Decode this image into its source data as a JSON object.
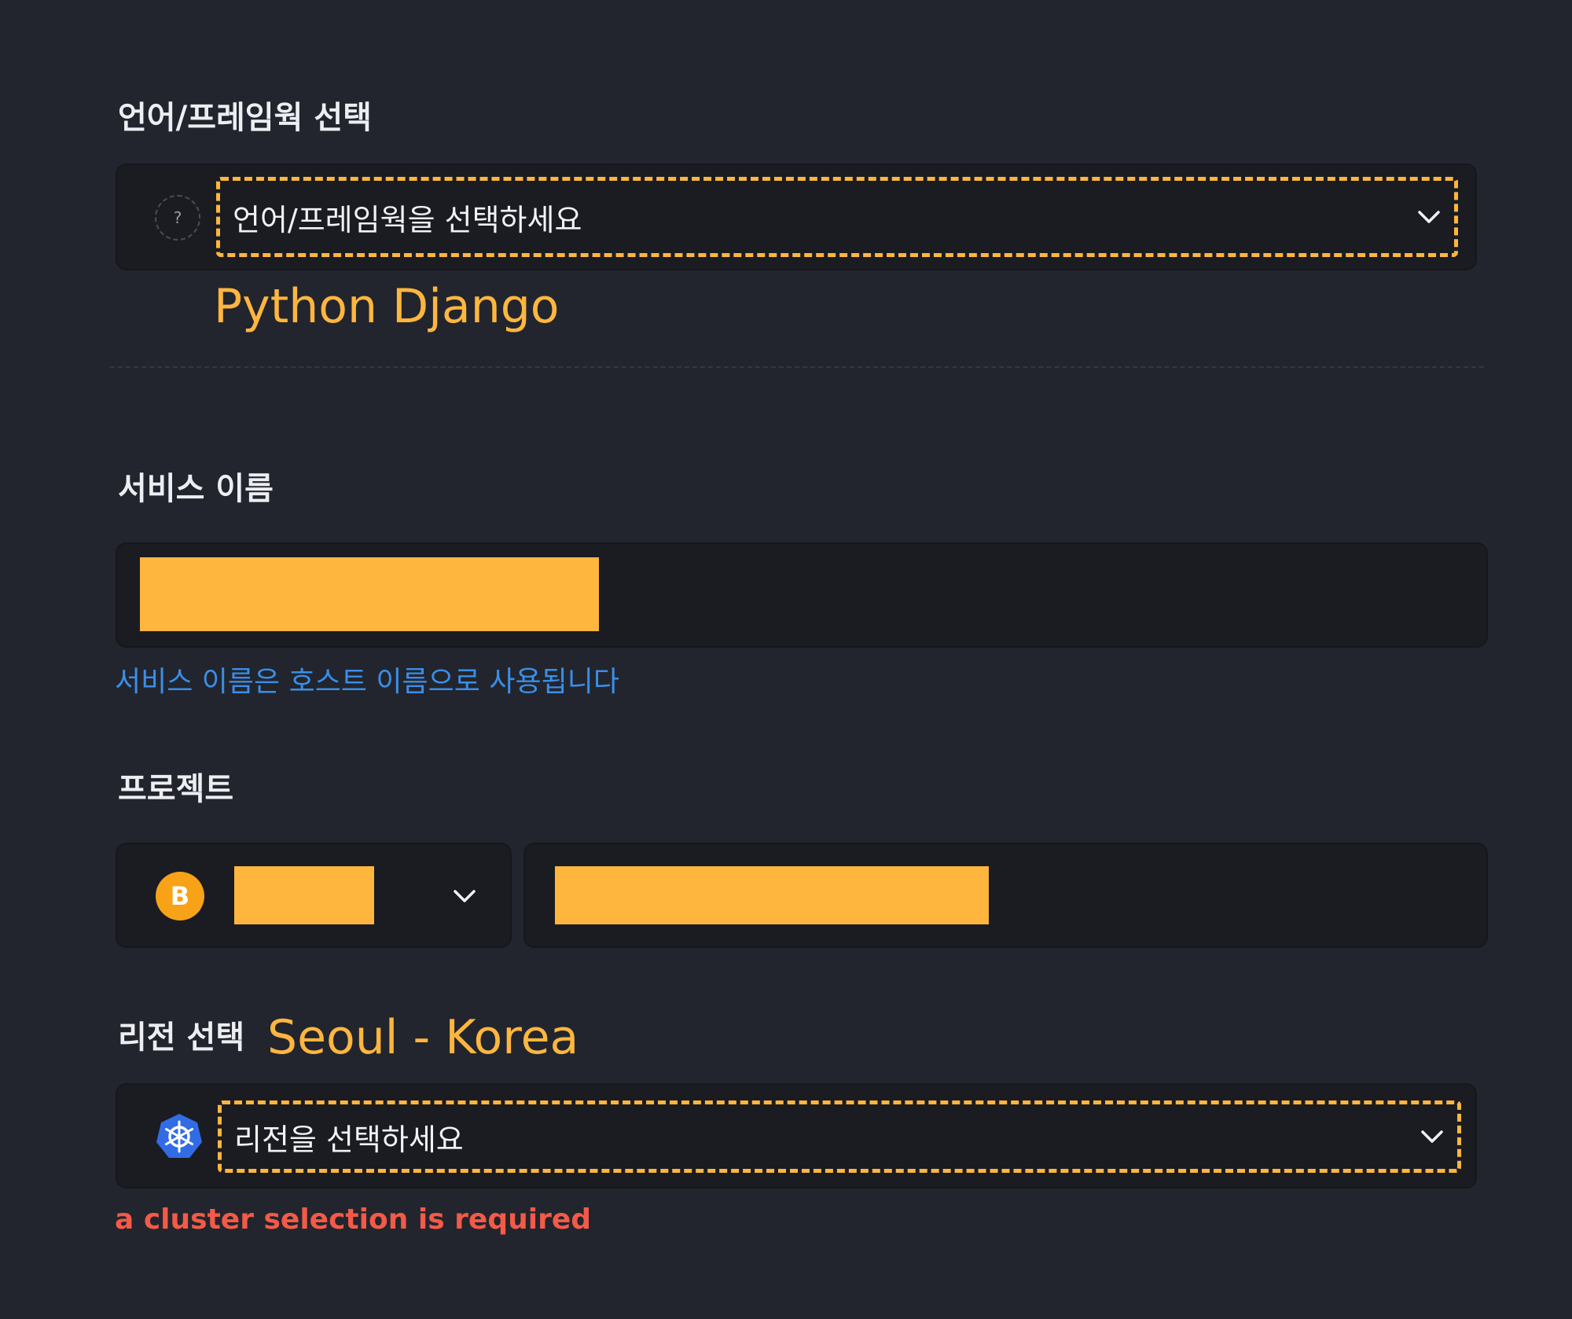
{
  "framework": {
    "label": "언어/프레임웍 선택",
    "placeholder": "언어/프레임웍을 선택하세요",
    "selected_note": "Python Django",
    "icon": "question-mark-icon",
    "icon_glyph": "?"
  },
  "service_name": {
    "label": "서비스 이름",
    "hint": "서비스 이름은 호스트 이름으로 사용됩니다"
  },
  "project": {
    "label": "프로젝트",
    "badge_letter": "B",
    "badge_color": "#f7a217"
  },
  "region": {
    "label": "리전 선택",
    "selected_note": "Seoul - Korea",
    "placeholder": "리전을 선택하세요",
    "icon": "kubernetes-icon",
    "error": "a cluster selection is required"
  },
  "colors": {
    "accent": "#feb63f",
    "hint": "#3a8ee8",
    "error": "#f35a48",
    "background": "#22252d",
    "field": "#1a1c22"
  }
}
